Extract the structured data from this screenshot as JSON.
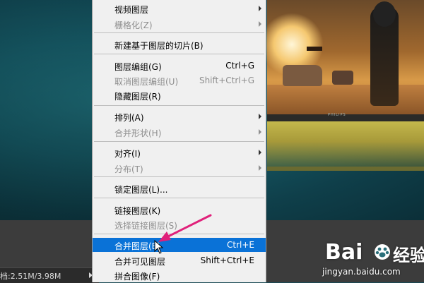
{
  "status": {
    "doc_info": "档:2.51M/3.98M"
  },
  "monitor": {
    "brand": "PHILIPS"
  },
  "menu": {
    "items": [
      {
        "label": "视频图层",
        "shortcut": "",
        "submenu": true,
        "disabled": false,
        "highlight": false
      },
      {
        "label": "栅格化(Z)",
        "shortcut": "",
        "submenu": true,
        "disabled": true,
        "highlight": false
      },
      {
        "label": "新建基于图层的切片(B)",
        "shortcut": "",
        "submenu": false,
        "disabled": false,
        "highlight": false
      },
      {
        "label": "图层编组(G)",
        "shortcut": "Ctrl+G",
        "submenu": false,
        "disabled": false,
        "highlight": false
      },
      {
        "label": "取消图层编组(U)",
        "shortcut": "Shift+Ctrl+G",
        "submenu": false,
        "disabled": true,
        "highlight": false
      },
      {
        "label": "隐藏图层(R)",
        "shortcut": "",
        "submenu": false,
        "disabled": false,
        "highlight": false
      },
      {
        "label": "排列(A)",
        "shortcut": "",
        "submenu": true,
        "disabled": false,
        "highlight": false
      },
      {
        "label": "合并形状(H)",
        "shortcut": "",
        "submenu": true,
        "disabled": true,
        "highlight": false
      },
      {
        "label": "对齐(I)",
        "shortcut": "",
        "submenu": true,
        "disabled": false,
        "highlight": false
      },
      {
        "label": "分布(T)",
        "shortcut": "",
        "submenu": true,
        "disabled": true,
        "highlight": false
      },
      {
        "label": "锁定图层(L)...",
        "shortcut": "",
        "submenu": false,
        "disabled": false,
        "highlight": false
      },
      {
        "label": "链接图层(K)",
        "shortcut": "",
        "submenu": false,
        "disabled": false,
        "highlight": false
      },
      {
        "label": "选择链接图层(S)",
        "shortcut": "",
        "submenu": false,
        "disabled": true,
        "highlight": false
      },
      {
        "label": "合并图层(E)",
        "shortcut": "Ctrl+E",
        "submenu": false,
        "disabled": false,
        "highlight": true
      },
      {
        "label": "合并可见图层",
        "shortcut": "Shift+Ctrl+E",
        "submenu": false,
        "disabled": false,
        "highlight": false
      },
      {
        "label": "拼合图像(F)",
        "shortcut": "",
        "submenu": false,
        "disabled": false,
        "highlight": false
      }
    ]
  },
  "watermark": {
    "brand": "Bai",
    "brand2": "经验",
    "url": "jingyan.baidu.com"
  },
  "colors": {
    "highlight": "#0a72d7",
    "annotation_arrow": "#e0207a"
  }
}
